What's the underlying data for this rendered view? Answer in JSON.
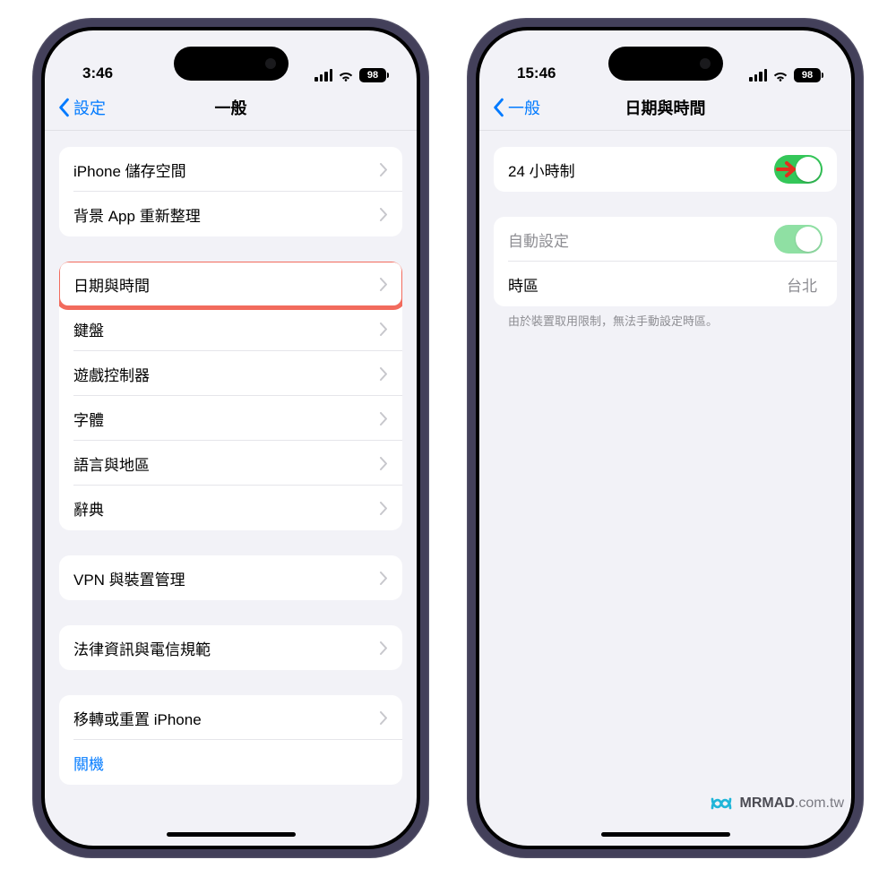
{
  "left": {
    "status_time": "3:46",
    "battery": "98",
    "nav_back": "設定",
    "nav_title": "一般",
    "g1": [
      {
        "label": "iPhone 儲存空間"
      },
      {
        "label": "背景 App 重新整理"
      }
    ],
    "g2": [
      {
        "label": "日期與時間"
      },
      {
        "label": "鍵盤"
      },
      {
        "label": "遊戲控制器"
      },
      {
        "label": "字體"
      },
      {
        "label": "語言與地區"
      },
      {
        "label": "辭典"
      }
    ],
    "g3": [
      {
        "label": "VPN 與裝置管理"
      }
    ],
    "g4": [
      {
        "label": "法律資訊與電信規範"
      }
    ],
    "g5": [
      {
        "label": "移轉或重置 iPhone"
      },
      {
        "label": "關機"
      }
    ]
  },
  "right": {
    "status_time": "15:46",
    "battery": "98",
    "nav_back": "一般",
    "nav_title": "日期與時間",
    "row_24h": "24 小時制",
    "row_auto": "自動設定",
    "row_tz": "時區",
    "tz_value": "台北",
    "footer": "由於裝置取用限制，無法手動設定時區。"
  },
  "watermark": {
    "brand": "MRMAD",
    "domain": ".com.tw"
  }
}
